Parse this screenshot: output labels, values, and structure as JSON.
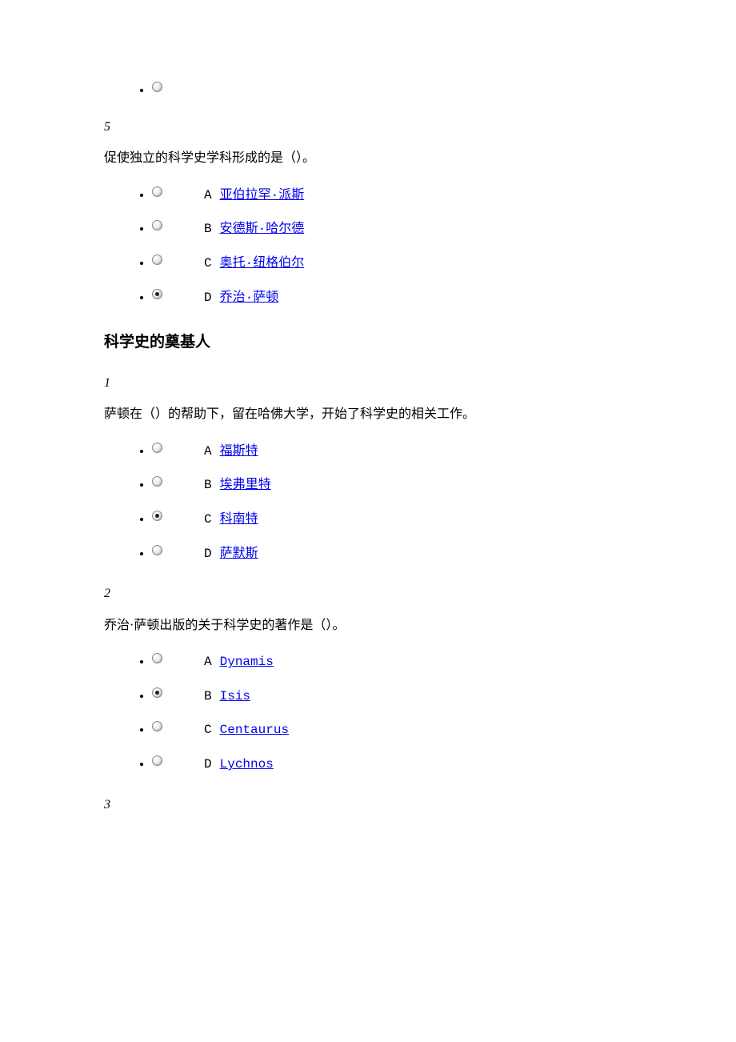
{
  "orphan_option": {
    "selected": false
  },
  "q5": {
    "number": "5",
    "text": "促使独立的科学史学科形成的是（）。",
    "options": [
      {
        "letter": "A",
        "link": "亚伯拉罕·派斯",
        "selected": false
      },
      {
        "letter": "B",
        "link": "安德斯·哈尔德",
        "selected": false
      },
      {
        "letter": "C",
        "link": "奥托·纽格伯尔",
        "selected": false
      },
      {
        "letter": "D",
        "link": "乔治·萨顿",
        "selected": true
      }
    ]
  },
  "section": {
    "title": "科学史的奠基人"
  },
  "s1": {
    "number": "1",
    "text": "萨顿在（）的帮助下，留在哈佛大学，开始了科学史的相关工作。",
    "options": [
      {
        "letter": "A",
        "link": "福斯特",
        "selected": false
      },
      {
        "letter": "B",
        "link": "埃弗里特",
        "selected": false
      },
      {
        "letter": "C",
        "link": "科南特",
        "selected": true
      },
      {
        "letter": "D",
        "link": "萨默斯",
        "selected": false
      }
    ]
  },
  "s2": {
    "number": "2",
    "text": "乔治·萨顿出版的关于科学史的著作是（）。",
    "options": [
      {
        "letter": "A",
        "link": "Dynamis",
        "selected": false
      },
      {
        "letter": "B",
        "link": "Isis",
        "selected": true
      },
      {
        "letter": "C",
        "link": "Centaurus",
        "selected": false
      },
      {
        "letter": "D",
        "link": "Lychnos",
        "selected": false
      }
    ]
  },
  "s3": {
    "number": "3"
  }
}
